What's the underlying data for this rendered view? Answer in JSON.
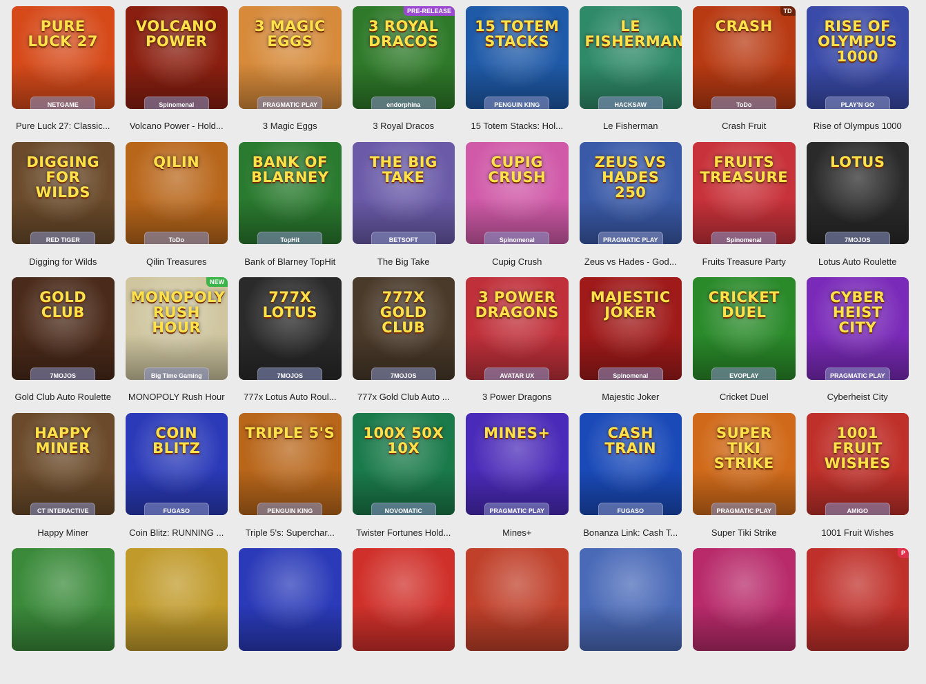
{
  "games": [
    {
      "title": "Pure Luck 27: Classic...",
      "art": "Pure Luck 27",
      "provider": "NETGAME",
      "bg": "#d64a1a",
      "badge": ""
    },
    {
      "title": "Volcano Power - Hold...",
      "art": "Volcano Power",
      "provider": "Spinomenal",
      "bg": "#8a1f10",
      "badge": ""
    },
    {
      "title": "3 Magic Eggs",
      "art": "3 Magic Eggs",
      "provider": "PRAGMATIC PLAY",
      "bg": "#d68a3a",
      "badge": ""
    },
    {
      "title": "3 Royal Dracos",
      "art": "3 Royal Dracos",
      "provider": "endorphina",
      "bg": "#2f7a2a",
      "badge": "PRE-RELEASE"
    },
    {
      "title": "15 Totem Stacks: Hol...",
      "art": "15 Totem Stacks",
      "provider": "PENGUIN KING",
      "bg": "#1f5aa8",
      "badge": ""
    },
    {
      "title": "Le Fisherman",
      "art": "Le Fisherman",
      "provider": "HACKSAW",
      "bg": "#2f8a6a",
      "badge": ""
    },
    {
      "title": "Crash Fruit",
      "art": "Crash",
      "provider": "ToDo",
      "bg": "#b83a12",
      "badge": "TD"
    },
    {
      "title": "Rise of Olympus 1000",
      "art": "Rise of Olympus 1000",
      "provider": "PLAY'N GO",
      "bg": "#3a4aa8",
      "badge": ""
    },
    {
      "title": "Digging for Wilds",
      "art": "Digging for Wilds",
      "provider": "RED TIGER",
      "bg": "#6a4a2a",
      "badge": ""
    },
    {
      "title": "Qilin Treasures",
      "art": "Qilin",
      "provider": "ToDo",
      "bg": "#b8661a",
      "badge": ""
    },
    {
      "title": "Bank of Blarney TopHit",
      "art": "Bank of Blarney",
      "provider": "TopHit",
      "bg": "#2a7a2f",
      "badge": ""
    },
    {
      "title": "The Big Take",
      "art": "The Big Take",
      "provider": "BETSOFT",
      "bg": "#6a5aa8",
      "badge": ""
    },
    {
      "title": "Cupig Crush",
      "art": "Cupig Crush",
      "provider": "Spinomenal",
      "bg": "#d05aa8",
      "badge": ""
    },
    {
      "title": "Zeus vs Hades - God...",
      "art": "Zeus vs Hades 250",
      "provider": "PRAGMATIC PLAY",
      "bg": "#3a5aa8",
      "badge": ""
    },
    {
      "title": "Fruits Treasure Party",
      "art": "Fruits Treasure",
      "provider": "Spinomenal",
      "bg": "#c8323a",
      "badge": ""
    },
    {
      "title": "Lotus Auto Roulette",
      "art": "Lotus",
      "provider": "7MOJOS",
      "bg": "#2a2a2a",
      "badge": ""
    },
    {
      "title": "Gold Club Auto Roulette",
      "art": "Gold Club",
      "provider": "7MOJOS",
      "bg": "#4a2a1a",
      "badge": ""
    },
    {
      "title": "MONOPOLY Rush Hour",
      "art": "Monopoly Rush Hour",
      "provider": "Big Time Gaming",
      "bg": "#cfc6a0",
      "badge": "NEW"
    },
    {
      "title": "777x Lotus Auto Roul...",
      "art": "777x Lotus",
      "provider": "7MOJOS",
      "bg": "#2a2a2a",
      "badge": ""
    },
    {
      "title": "777x Gold Club Auto ...",
      "art": "777x Gold Club",
      "provider": "7MOJOS",
      "bg": "#4a3a2a",
      "badge": ""
    },
    {
      "title": "3 Power Dragons",
      "art": "3 Power Dragons",
      "provider": "AVATAR UX",
      "bg": "#c0303a",
      "badge": ""
    },
    {
      "title": "Majestic Joker",
      "art": "Majestic Joker",
      "provider": "Spinomenal",
      "bg": "#a01a1a",
      "badge": ""
    },
    {
      "title": "Cricket Duel",
      "art": "Cricket Duel",
      "provider": "EVOPLAY",
      "bg": "#2a8a2a",
      "badge": ""
    },
    {
      "title": "Cyberheist City",
      "art": "Cyber Heist City",
      "provider": "PRAGMATIC PLAY",
      "bg": "#7a2ab8",
      "badge": ""
    },
    {
      "title": "Happy Miner",
      "art": "Happy Miner",
      "provider": "CT INTERACTIVE",
      "bg": "#6a4a2a",
      "badge": ""
    },
    {
      "title": "Coin Blitz: RUNNING ...",
      "art": "Coin Blitz",
      "provider": "FUGASO",
      "bg": "#2a3ab8",
      "badge": ""
    },
    {
      "title": "Triple 5's: Superchar...",
      "art": "Triple 5's",
      "provider": "PENGUIN KING",
      "bg": "#b8661a",
      "badge": ""
    },
    {
      "title": "Twister Fortunes Hold...",
      "art": "100X 50X 10X",
      "provider": "NOVOMATIC",
      "bg": "#1a7a4a",
      "badge": ""
    },
    {
      "title": "Mines+",
      "art": "Mines+",
      "provider": "PRAGMATIC PLAY",
      "bg": "#4a2ab8",
      "badge": ""
    },
    {
      "title": "Bonanza Link: Cash T...",
      "art": "Cash Train",
      "provider": "FUGASO",
      "bg": "#1a4ab8",
      "badge": ""
    },
    {
      "title": "Super Tiki Strike",
      "art": "Super Tiki Strike",
      "provider": "PRAGMATIC PLAY",
      "bg": "#d06a1a",
      "badge": ""
    },
    {
      "title": "1001 Fruit Wishes",
      "art": "1001 Fruit Wishes",
      "provider": "AMIGO",
      "bg": "#c0302a",
      "badge": ""
    },
    {
      "title": "",
      "art": "",
      "provider": "",
      "bg": "#3a8a3a",
      "badge": ""
    },
    {
      "title": "",
      "art": "",
      "provider": "",
      "bg": "#c09a2a",
      "badge": ""
    },
    {
      "title": "",
      "art": "",
      "provider": "",
      "bg": "#2a3ab8",
      "badge": ""
    },
    {
      "title": "",
      "art": "",
      "provider": "",
      "bg": "#d0302a",
      "badge": ""
    },
    {
      "title": "",
      "art": "",
      "provider": "",
      "bg": "#c0402a",
      "badge": ""
    },
    {
      "title": "",
      "art": "",
      "provider": "",
      "bg": "#4a6ab8",
      "badge": ""
    },
    {
      "title": "",
      "art": "",
      "provider": "",
      "bg": "#b82a6a",
      "badge": ""
    },
    {
      "title": "",
      "art": "",
      "provider": "",
      "bg": "#c0302a",
      "badge": "P"
    }
  ]
}
